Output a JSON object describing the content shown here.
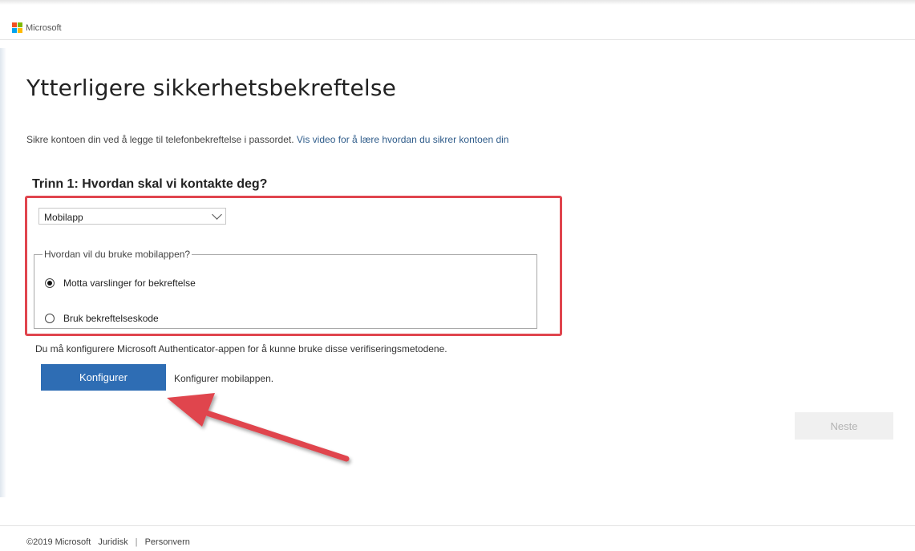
{
  "brand": {
    "name": "Microsoft",
    "logo_colors": [
      "#f25022",
      "#7fba00",
      "#00a4ef",
      "#ffb900"
    ]
  },
  "page": {
    "title": "Ytterligere sikkerhetsbekreftelse",
    "intro_text": "Sikre kontoen din ved å legge til telefonbekreftelse i passordet.",
    "intro_link": "Vis video for å lære hvordan du sikrer kontoen din"
  },
  "step1": {
    "heading": "Trinn 1: Hvordan skal vi kontakte deg?",
    "select_value": "Mobilapp",
    "fieldset_legend": "Hvordan vil du bruke mobilappen?",
    "options": [
      {
        "label": "Motta varslinger for bekreftelse",
        "selected": true
      },
      {
        "label": "Bruk bekreftelseskode",
        "selected": false
      }
    ],
    "notice": "Du må konfigurere Microsoft Authenticator-appen for å kunne bruke disse verifiseringsmetodene.",
    "configure_label": "Konfigurer",
    "configure_note": "Konfigurer mobilappen."
  },
  "actions": {
    "next_label": "Neste"
  },
  "footer": {
    "copyright": "©2019 Microsoft",
    "legal": "Juridisk",
    "separator": "|",
    "privacy": "Personvern"
  },
  "colors": {
    "accent": "#2e6db4",
    "highlight": "#e0454e",
    "link": "#2f5c8a"
  }
}
